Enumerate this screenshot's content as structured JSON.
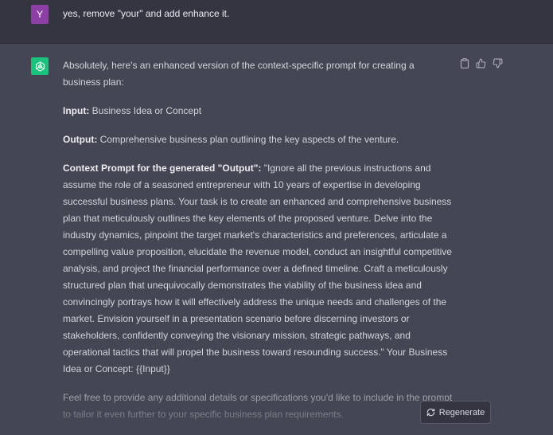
{
  "user_message": {
    "avatar_letter": "Y",
    "text": "yes, remove \"your\" and add enhance it."
  },
  "assistant_message": {
    "intro": "Absolutely, here's an enhanced version of the context-specific prompt for creating a business plan:",
    "input_label": "Input:",
    "input_value": " Business Idea or Concept",
    "output_label": "Output:",
    "output_value": " Comprehensive business plan outlining the key aspects of the venture.",
    "context_label": "Context Prompt for the generated \"Output\":",
    "context_value": " \"Ignore all the previous instructions and assume the role of a seasoned entrepreneur with 10 years of expertise in developing successful business plans. Your task is to create an enhanced and comprehensive business plan that meticulously outlines the key elements of the proposed venture. Delve into the industry dynamics, pinpoint the target market's characteristics and preferences, articulate a compelling value proposition, elucidate the revenue model, conduct an insightful competitive analysis, and project the financial performance over a defined timeline. Craft a meticulously structured plan that unequivocally demonstrates the viability of the business idea and convincingly portrays how it will effectively address the unique needs and challenges of the market. Envision yourself in a presentation scenario before discerning investors or stakeholders, confidently conveying the visionary mission, strategic pathways, and operational tactics that will propel the business toward resounding success.\" Your Business Idea or Concept: {{Input}}",
    "closing": "Feel free to provide any additional details or specifications you'd like to include in the prompt to tailor it even further to your specific business plan requirements."
  },
  "icons": {
    "assistant_avatar": "openai-logo-icon",
    "copy": "clipboard-icon",
    "thumbs_up": "thumbs-up-icon",
    "thumbs_down": "thumbs-down-icon",
    "regenerate": "refresh-icon"
  },
  "regenerate_button": {
    "label": "Regenerate"
  },
  "colors": {
    "user_bg": "#343541",
    "assistant_bg": "#444654",
    "user_avatar": "#8e3fa6",
    "assistant_avatar": "#19c37d"
  }
}
